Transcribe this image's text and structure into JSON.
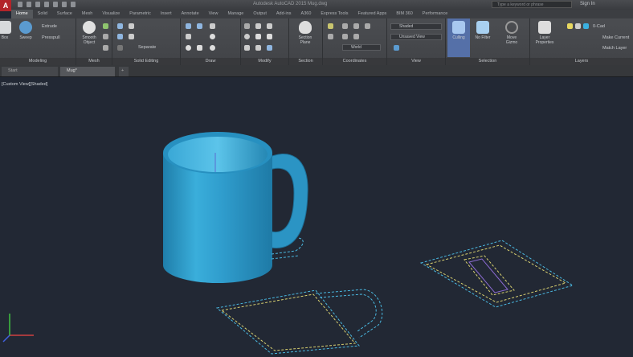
{
  "titlebar": {
    "app_logo": "A",
    "title": "Autodesk AutoCAD 2015   Mug.dwg",
    "search_placeholder": "Type a keyword or phrase",
    "sign_in": "Sign In"
  },
  "ribbon_tabs": [
    "Home",
    "Solid",
    "Surface",
    "Mesh",
    "Visualize",
    "Parametric",
    "Insert",
    "Annotate",
    "View",
    "Manage",
    "Output",
    "Add-ins",
    "A360",
    "Express Tools",
    "Featured Apps",
    "BIM 360",
    "Performance"
  ],
  "panels": {
    "modeling": {
      "label": "Modeling",
      "box": "Box",
      "sweep": "Sweep",
      "extrude": "Extrude",
      "presspull": "Presspull"
    },
    "mesh": {
      "label": "Mesh",
      "smooth": "Smooth Object"
    },
    "solid_editing": {
      "label": "Solid Editing",
      "separate": "Separate"
    },
    "draw": {
      "label": "Draw"
    },
    "modify": {
      "label": "Modify"
    },
    "section": {
      "label": "Section",
      "section_plane": "Section Plane"
    },
    "coordinates": {
      "label": "Coordinates",
      "world": "World"
    },
    "view": {
      "label": "View",
      "visual_style": "Shaded",
      "named_view": "Unsaved View"
    },
    "selection": {
      "label": "Selection",
      "culling": "Culling",
      "no_filter": "No Filter",
      "gizmo": "Move Gizmo"
    },
    "layers": {
      "label": "Layers",
      "layer_properties": "Layer Properties",
      "current_layer": "0-Cad",
      "make_current": "Make Current",
      "match_layer": "Match Layer"
    }
  },
  "doc_tabs": [
    "Start",
    "Mug*"
  ],
  "viewport": {
    "label": "[Custom View][Shaded]"
  },
  "colors": {
    "mug": "#2f9ccc",
    "background": "#222834",
    "sketch_cyan": "#4ab8e0",
    "sketch_yellow": "#d8d070"
  }
}
